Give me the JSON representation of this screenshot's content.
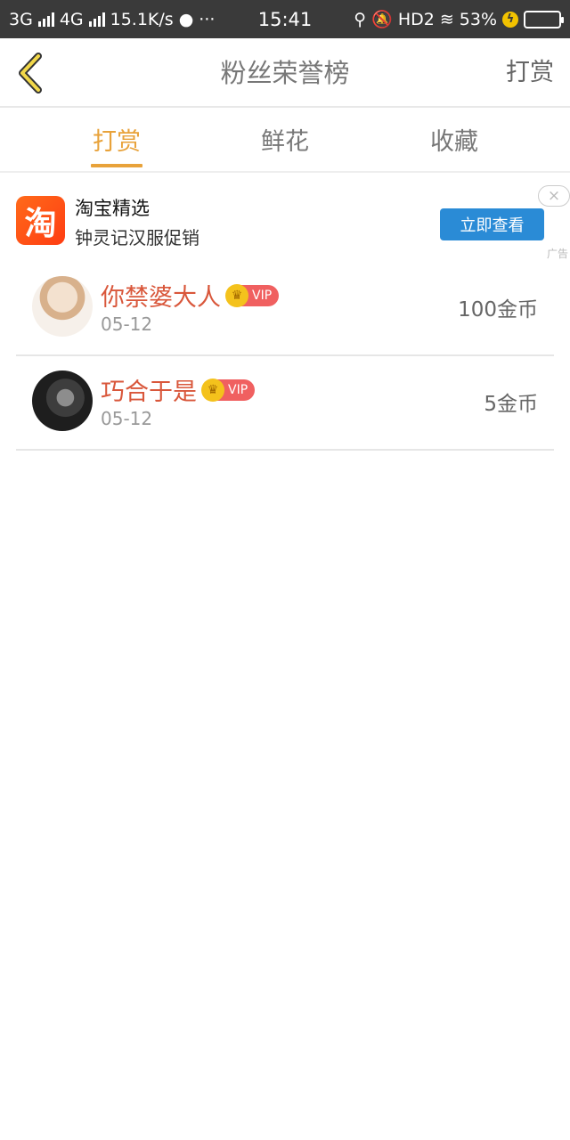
{
  "status_bar": {
    "network_1": "3G",
    "network_2": "4G",
    "speed": "15.1K/s",
    "dots": "···",
    "time": "15:41",
    "hd": "HD2",
    "battery_percent": "53%",
    "battery_level": 0.53
  },
  "header": {
    "title": "粉丝荣誉榜",
    "action": "打赏"
  },
  "tabs": [
    {
      "label": "打赏",
      "active": true
    },
    {
      "label": "鲜花",
      "active": false
    },
    {
      "label": "收藏",
      "active": false
    }
  ],
  "ad": {
    "logo_char": "淘",
    "title": "淘宝精选",
    "subtitle": "钟灵记汉服促销",
    "button": "立即查看",
    "close": "×",
    "tag": "广告"
  },
  "rank_list": [
    {
      "name": "你禁婆大人",
      "vip": "VIP",
      "date": "05-12",
      "amount": "100金币"
    },
    {
      "name": "巧合于是",
      "vip": "VIP",
      "date": "05-12",
      "amount": "5金币"
    }
  ],
  "colors": {
    "accent": "#e8a23a",
    "name": "#d9573b",
    "ad_button": "#2a8bd6",
    "status_bg": "#3a3a3a"
  }
}
